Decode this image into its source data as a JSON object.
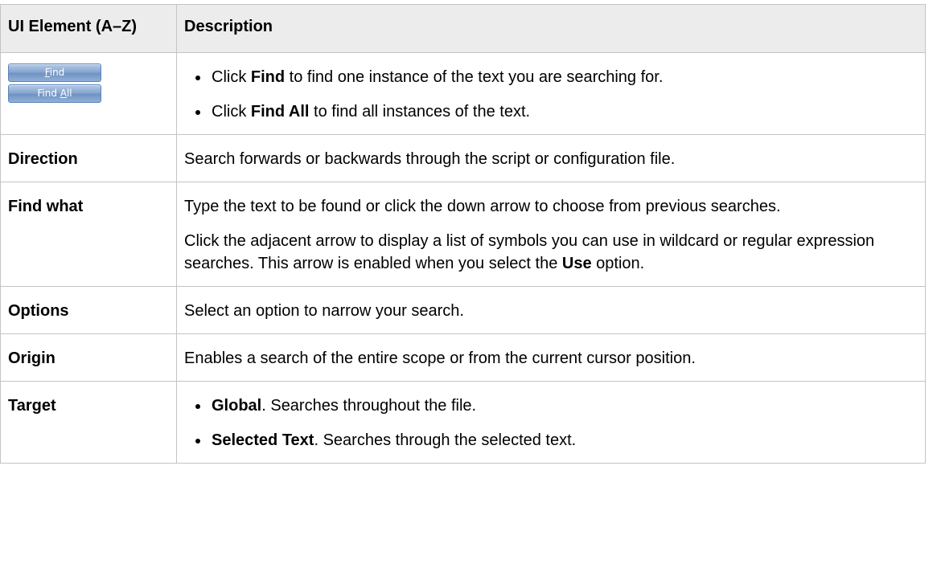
{
  "header": {
    "col_element": "UI Element (A–Z)",
    "col_description": "Description"
  },
  "rows": [
    {
      "buttons": [
        {
          "label_mnemonic": "F",
          "label_rest": "ind"
        },
        {
          "label_before": "Find ",
          "label_mnemonic": "A",
          "label_rest": "ll"
        }
      ],
      "bullets": [
        {
          "pre": "Click ",
          "bold": "Find",
          "post": " to find one instance of the text you are searching for."
        },
        {
          "pre": "Click ",
          "bold": "Find All",
          "post": " to find all instances of the text."
        }
      ]
    },
    {
      "element": "Direction",
      "description": "Search forwards or backwards through the script or configuration file."
    },
    {
      "element": "Find what",
      "para1": "Type the text to be found or click the down arrow to choose from previous searches.",
      "para2_pre": "Click the adjacent arrow to display a list of symbols you can use in wildcard or regular expression searches. This arrow is enabled when you select the ",
      "para2_bold": "Use",
      "para2_post": " option."
    },
    {
      "element": "Options",
      "description": "Select an option to narrow your search."
    },
    {
      "element": "Origin",
      "description": "Enables a search of the entire scope or from the current cursor position."
    },
    {
      "element": "Target",
      "bullets": [
        {
          "bold": "Global",
          "post": ". Searches throughout the file."
        },
        {
          "bold": "Selected Text",
          "post": ". Searches through the selected text."
        }
      ]
    }
  ]
}
